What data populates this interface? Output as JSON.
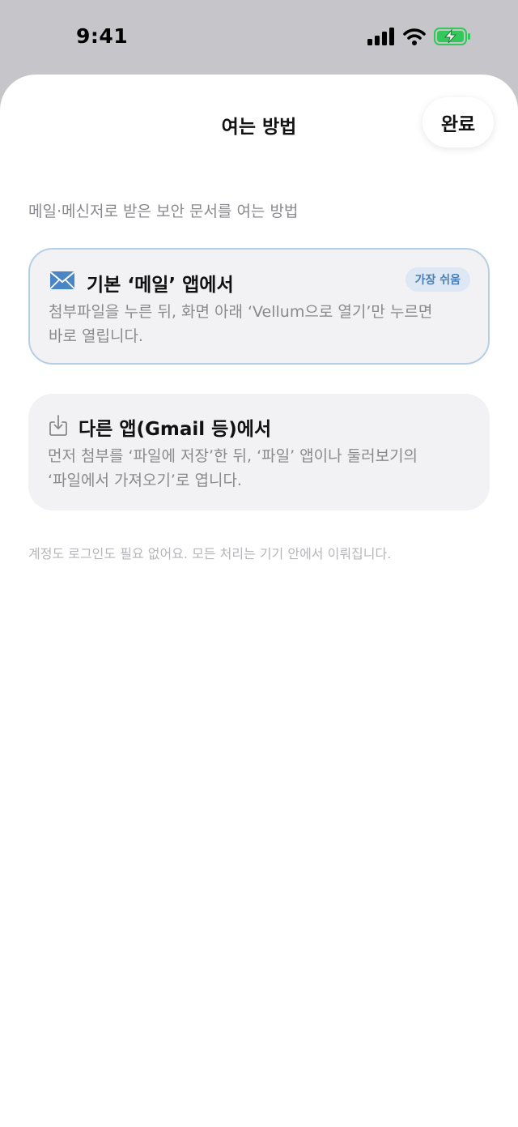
{
  "status_bar": {
    "time": "9:41",
    "icons": [
      "signal-icon",
      "wifi-icon",
      "battery-charging-icon"
    ]
  },
  "sheet": {
    "title": "여는 방법",
    "done_label": "완료",
    "subtitle": "메일·메신저로 받은 보안 문서를 여는 방법",
    "cards": [
      {
        "icon": "mail-icon",
        "title": "기본 ‘메일’ 앱에서",
        "badge": "가장 쉬움",
        "description_lines": [
          "첨부파일을 누른 뒤, 화면 아래 ‘Vellum으로 열기’만 누르면",
          "바로 열립니다."
        ]
      },
      {
        "icon": "download-tray-icon",
        "title": "다른 앱(Gmail 등)에서",
        "description_lines": [
          "먼저 첨부를 ‘파일에 저장’한 뒤, ‘파일’ 앱이나 둘러보기의",
          "‘파일에서 가져오기’로 엽니다."
        ]
      }
    ],
    "footnote": "계정도 로그인도 필요 없어요. 모든 처리는 기기 안에서 이뤄집니다."
  },
  "colors": {
    "accent": "#4a7fb5",
    "badge_bg": "#dde8f4",
    "card_bg": "#f2f2f4",
    "card_highlight_border": "#b6cfe6",
    "battery_fill": "#34c759"
  }
}
